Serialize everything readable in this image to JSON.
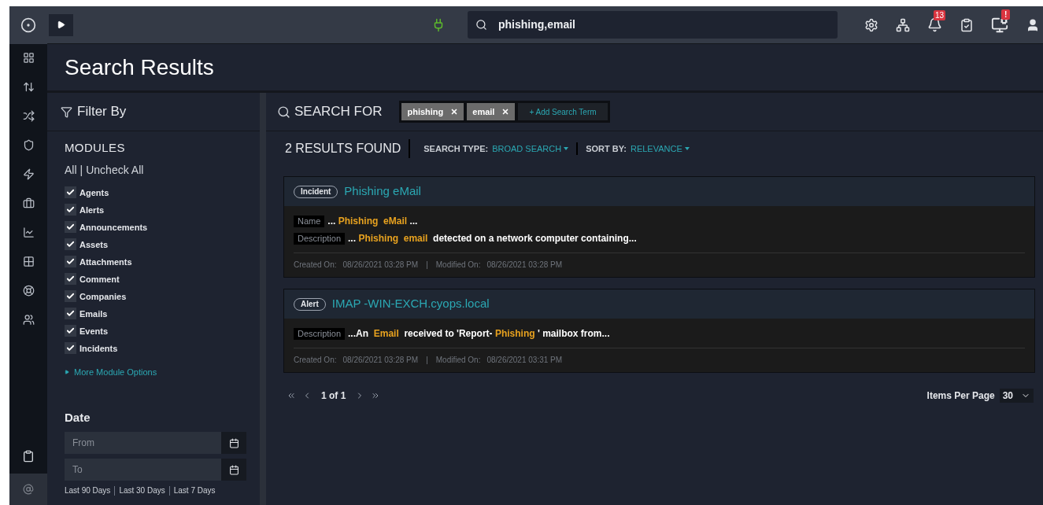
{
  "topbar": {
    "search": {
      "value": "phishing,email"
    },
    "notifications_badge": "13",
    "alerts_badge": "!"
  },
  "page": {
    "title": "Search Results"
  },
  "filter": {
    "title": "Filter By",
    "modules_heading": "MODULES",
    "select_all": "All",
    "separator": "|",
    "uncheck_all": "Uncheck All",
    "modules": [
      {
        "label": "Agents",
        "checked": true
      },
      {
        "label": "Alerts",
        "checked": true
      },
      {
        "label": "Announcements",
        "checked": true
      },
      {
        "label": "Assets",
        "checked": true
      },
      {
        "label": "Attachments",
        "checked": true
      },
      {
        "label": "Comment",
        "checked": true
      },
      {
        "label": "Companies",
        "checked": true
      },
      {
        "label": "Emails",
        "checked": true
      },
      {
        "label": "Events",
        "checked": true
      },
      {
        "label": "Incidents",
        "checked": true
      }
    ],
    "more_options": "More Module Options",
    "date_heading": "Date",
    "from_placeholder": "From",
    "to_placeholder": "To",
    "quick_ranges": [
      "Last 90 Days",
      "Last 30 Days",
      "Last 7 Days"
    ]
  },
  "search_for": {
    "label": "SEARCH FOR",
    "terms": [
      "phishing",
      "email"
    ],
    "add_term": "+ Add Search Term"
  },
  "results_bar": {
    "count": "2 RESULTS FOUND",
    "search_type_label": "SEARCH TYPE:",
    "search_type": "BROAD SEARCH",
    "sort_label": "SORT BY:",
    "sort": "RELEVANCE"
  },
  "results": [
    {
      "type": "Incident",
      "title": "Phishing eMail",
      "fields": [
        {
          "label": "Name",
          "segments": [
            {
              "text": "... ",
              "highlight": false
            },
            {
              "text": "Phishing  ",
              "highlight": true
            },
            {
              "text": "eMail",
              "highlight": true
            },
            {
              "text": " ...",
              "highlight": false
            }
          ]
        },
        {
          "label": "Description",
          "segments": [
            {
              "text": "... ",
              "highlight": false
            },
            {
              "text": "Phishing  ",
              "highlight": true
            },
            {
              "text": "email",
              "highlight": true
            },
            {
              "text": "  detected on a network computer containing...",
              "highlight": false
            }
          ]
        }
      ],
      "created_label": "Created On:",
      "created": "08/26/2021 03:28 PM",
      "separator": "|",
      "modified_label": "Modified On:",
      "modified": "08/26/2021 03:28 PM"
    },
    {
      "type": "Alert",
      "title": "IMAP -WIN-EXCH.cyops.local",
      "fields": [
        {
          "label": "Description",
          "segments": [
            {
              "text": "...An  ",
              "highlight": false
            },
            {
              "text": "Email",
              "highlight": true
            },
            {
              "text": "  received to 'Report- ",
              "highlight": false
            },
            {
              "text": "Phishing",
              "highlight": true
            },
            {
              "text": " ' mailbox from...",
              "highlight": false
            }
          ]
        }
      ],
      "created_label": "Created On:",
      "created": "08/26/2021 03:28 PM",
      "separator": "|",
      "modified_label": "Modified On:",
      "modified": "08/26/2021 03:31 PM"
    }
  ],
  "pagination": {
    "page": "1 of 1",
    "items_per_page_label": "Items Per Page",
    "items_per_page": "30"
  }
}
